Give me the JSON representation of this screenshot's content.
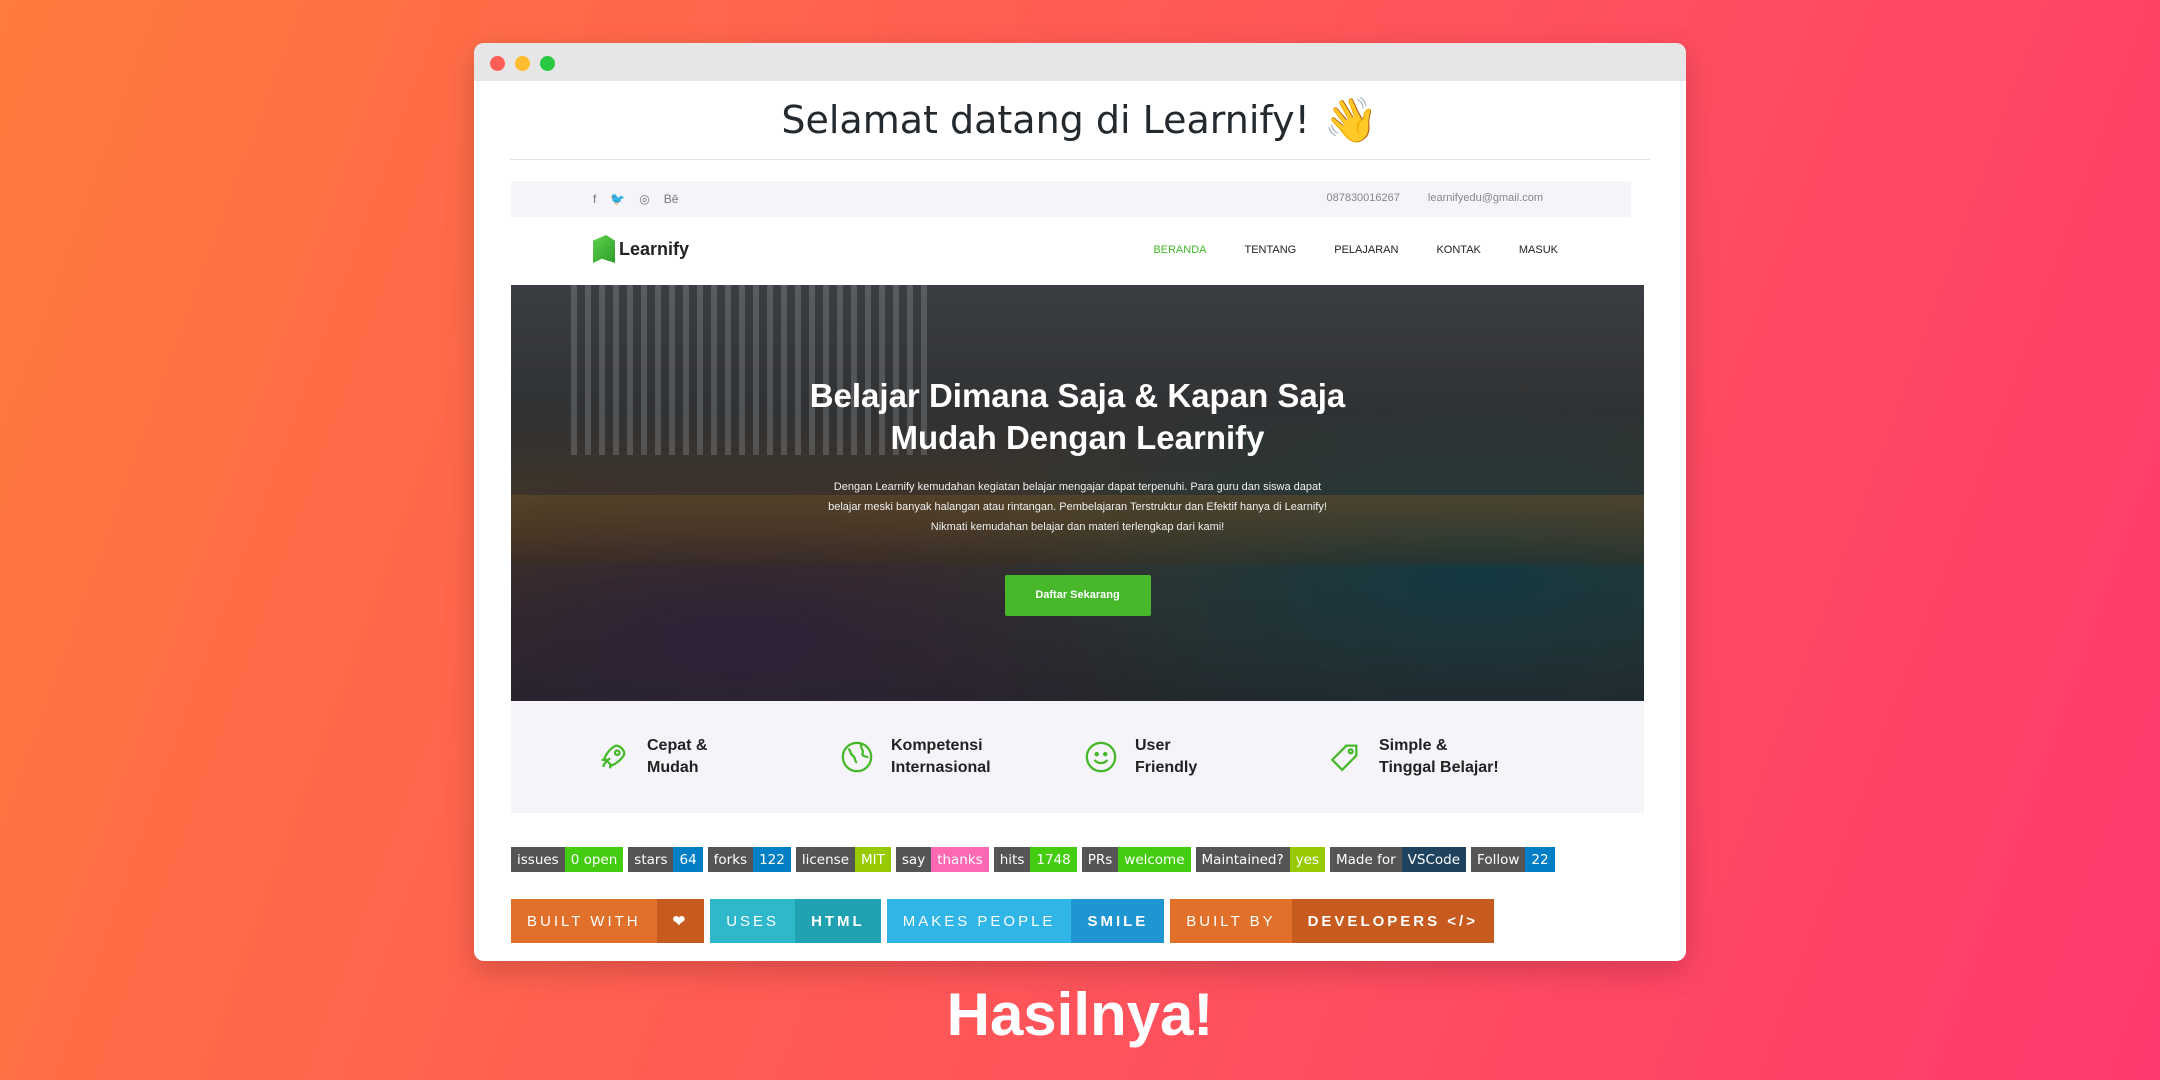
{
  "window": {
    "title": "Selamat datang di Learnify!",
    "wave_emoji": "👋"
  },
  "topbar": {
    "socials": [
      "f",
      "🐦",
      "◎",
      "Bē"
    ],
    "phone": "087830016267",
    "email": "learnifyedu@gmail.com"
  },
  "navbar": {
    "brand": "Learnify",
    "menu": [
      "BERANDA",
      "TENTANG",
      "PELAJARAN",
      "KONTAK",
      "MASUK"
    ]
  },
  "hero": {
    "title_line1": "Belajar Dimana Saja & Kapan Saja",
    "title_line2": "Mudah Dengan Learnify",
    "description": "Dengan Learnify kemudahan kegiatan belajar mengajar dapat terpenuhi. Para guru dan siswa dapat belajar meski banyak halangan atau rintangan. Pembelajaran Terstruktur dan Efektif hanya di Learnify! Nikmati kemudahan belajar dan materi terlengkap dari kami!",
    "cta": "Daftar Sekarang"
  },
  "features": [
    {
      "icon": "rocket-icon",
      "line1": "Cepat &",
      "line2": "Mudah"
    },
    {
      "icon": "globe-icon",
      "line1": "Kompetensi",
      "line2": "Internasional"
    },
    {
      "icon": "smile-icon",
      "line1": "User",
      "line2": "Friendly"
    },
    {
      "icon": "tag-icon",
      "line1": "Simple &",
      "line2": "Tinggal Belajar!"
    }
  ],
  "badges": [
    {
      "label": "issues",
      "value": "0 open",
      "color": "#4c1"
    },
    {
      "label": "stars",
      "value": "64",
      "color": "#007ec6"
    },
    {
      "label": "forks",
      "value": "122",
      "color": "#007ec6"
    },
    {
      "label": "license",
      "value": "MIT",
      "color": "#97ca00"
    },
    {
      "label": "say",
      "value": "thanks",
      "color": "#ff69b4"
    },
    {
      "label": "hits",
      "value": "1748",
      "color": "#4c1"
    },
    {
      "label": "PRs",
      "value": "welcome",
      "color": "#4c1"
    },
    {
      "label": "Maintained?",
      "value": "yes",
      "color": "#97ca00"
    },
    {
      "label": "Made for",
      "value": "VSCode",
      "color": "#1f425f"
    },
    {
      "label": "Follow",
      "value": "22",
      "color": "#007ec6"
    }
  ],
  "fat_badges": [
    {
      "label": "BUILT WITH",
      "value": "❤",
      "lcolor": "#e0702a",
      "rcolor": "#c75b1f"
    },
    {
      "label": "USES",
      "value": "HTML",
      "lcolor": "#2fb8c9",
      "rcolor": "#21a2b3"
    },
    {
      "label": "MAKES PEOPLE",
      "value": "SMILE",
      "lcolor": "#2fb5e6",
      "rcolor": "#1f95d2"
    },
    {
      "label": "BUILT BY",
      "value": "DEVELOPERS </>",
      "lcolor": "#e0702a",
      "rcolor": "#c75b1f"
    }
  ],
  "caption": "Hasilnya!"
}
